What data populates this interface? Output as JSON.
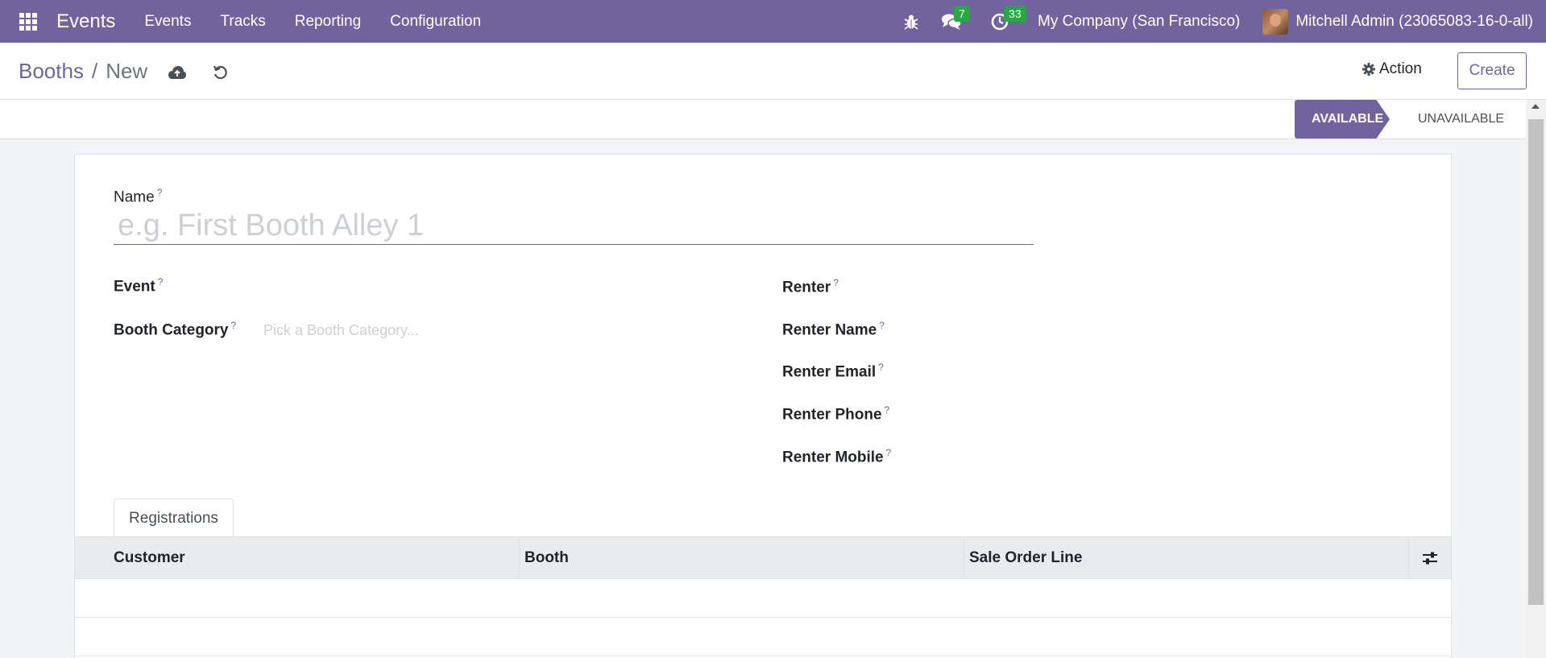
{
  "navbar": {
    "app_name": "Events",
    "menu": [
      "Events",
      "Tracks",
      "Reporting",
      "Configuration"
    ],
    "messages_count": "7",
    "activities_count": "33",
    "company": "My Company (San Francisco)",
    "user": "Mitchell Admin (23065083-16-0-all)"
  },
  "breadcrumb": {
    "parent": "Booths",
    "separator": "/",
    "current": "New"
  },
  "control": {
    "action_label": "Action",
    "create_label": "Create"
  },
  "statusbar": {
    "stages": [
      "AVAILABLE",
      "UNAVAILABLE"
    ],
    "active_stage": "AVAILABLE"
  },
  "form": {
    "name_label": "Name",
    "name_placeholder": "e.g. First Booth Alley 1",
    "help_marker": "?",
    "left_fields": {
      "event": "Event",
      "booth_category": "Booth Category",
      "booth_category_placeholder": "Pick a Booth Category..."
    },
    "right_fields": {
      "renter": "Renter",
      "renter_name": "Renter Name",
      "renter_email": "Renter Email",
      "renter_phone": "Renter Phone",
      "renter_mobile": "Renter Mobile"
    }
  },
  "tabs": {
    "registrations": "Registrations"
  },
  "table": {
    "columns": [
      "Customer",
      "Booth",
      "Sale Order Line"
    ],
    "rows": []
  },
  "colors": {
    "brand": "#71639e",
    "badge": "#28a745"
  }
}
